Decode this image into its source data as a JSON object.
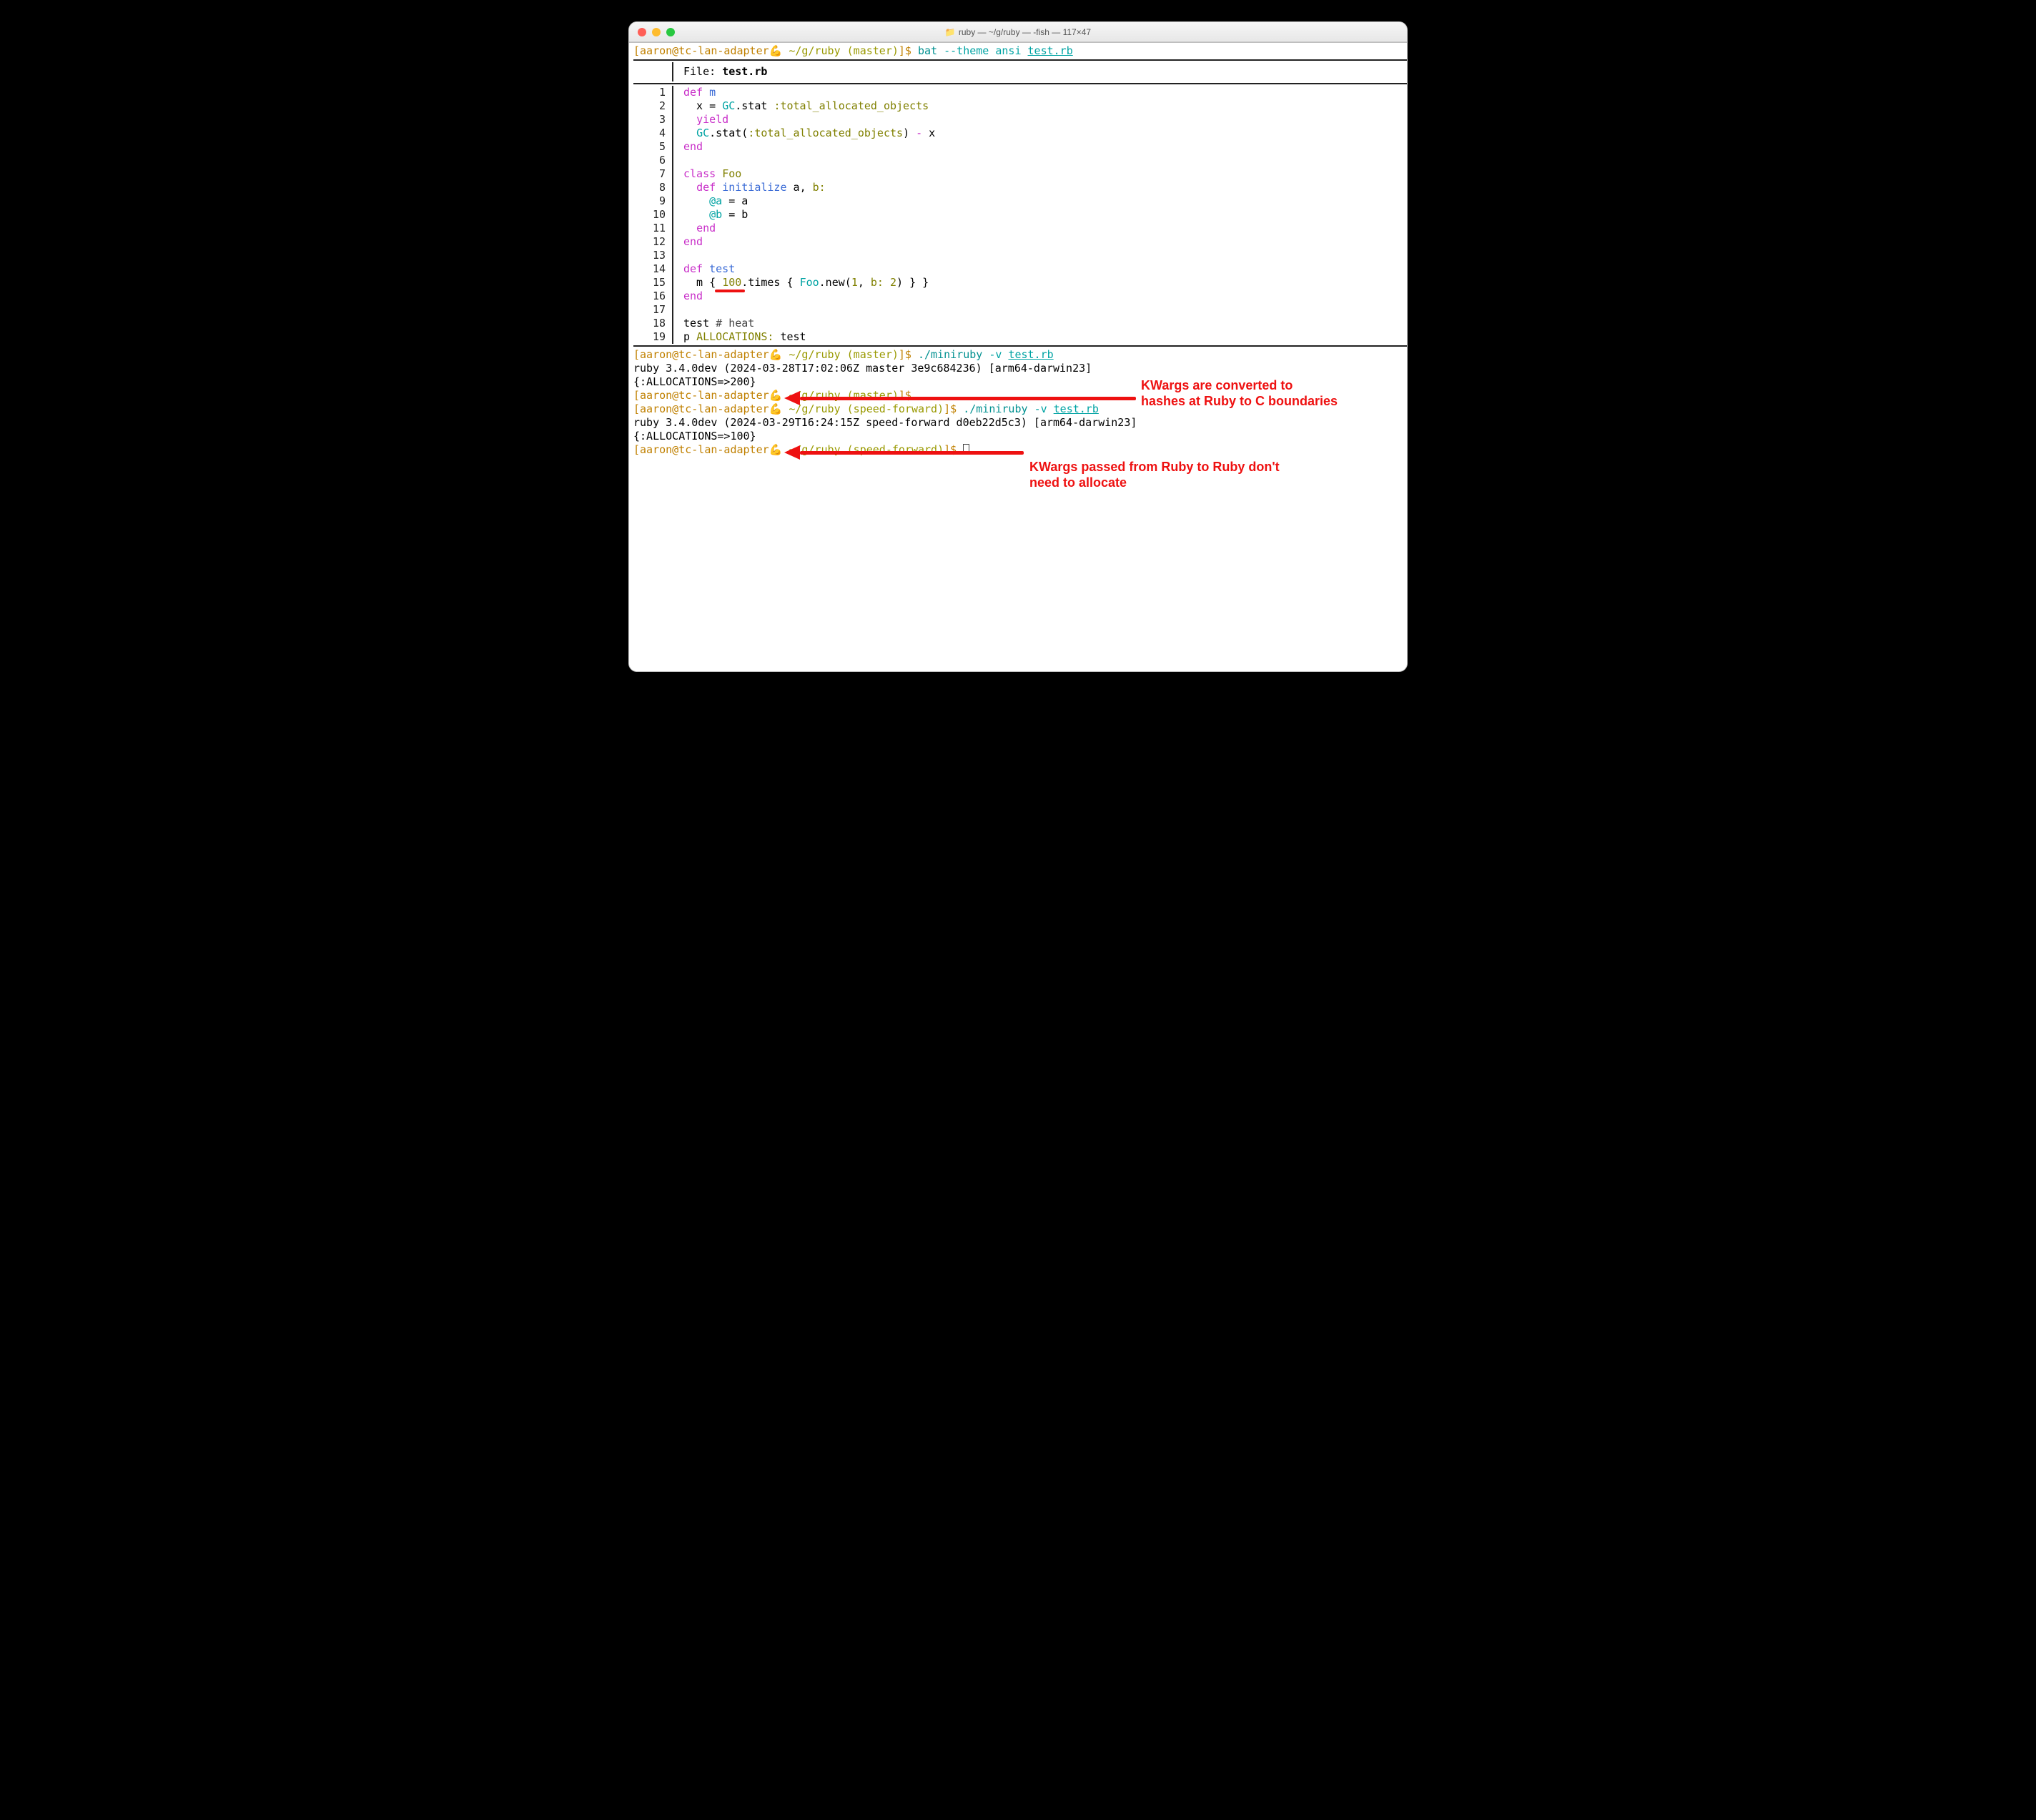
{
  "window": {
    "title": "ruby — ~/g/ruby — -fish — 117×47",
    "folder_icon": "📁"
  },
  "prompt_top": {
    "user_host": "[aaron@tc-lan-adapter",
    "emoji": "💪",
    "path_branch": "~/g/ruby (master)",
    "sigil": "]$ ",
    "cmd": "bat ",
    "opt": "--theme ansi ",
    "arg": "test.rb"
  },
  "bat": {
    "file_label": "File: ",
    "file_name": "test.rb",
    "lines": [
      {
        "n": "1",
        "tokens": [
          [
            "def ",
            "c-magenta"
          ],
          [
            "m",
            "c-blue"
          ]
        ]
      },
      {
        "n": "2",
        "tokens": [
          [
            "  x = ",
            ""
          ],
          [
            "GC",
            "c-cyan"
          ],
          [
            ".stat ",
            ""
          ],
          [
            ":total_allocated_objects",
            "c-olive"
          ]
        ]
      },
      {
        "n": "3",
        "tokens": [
          [
            "  ",
            ""
          ],
          [
            "yield",
            "c-magenta"
          ]
        ]
      },
      {
        "n": "4",
        "tokens": [
          [
            "  ",
            ""
          ],
          [
            "GC",
            "c-cyan"
          ],
          [
            ".stat(",
            ""
          ],
          [
            ":total_allocated_objects",
            "c-olive"
          ],
          [
            ") ",
            ""
          ],
          [
            "-",
            "c-magenta"
          ],
          [
            " x",
            ""
          ]
        ]
      },
      {
        "n": "5",
        "tokens": [
          [
            "end",
            "c-magenta"
          ]
        ]
      },
      {
        "n": "6",
        "tokens": [
          [
            "",
            ""
          ]
        ]
      },
      {
        "n": "7",
        "tokens": [
          [
            "class ",
            "c-magenta"
          ],
          [
            "Foo",
            "c-olive"
          ]
        ]
      },
      {
        "n": "8",
        "tokens": [
          [
            "  ",
            ""
          ],
          [
            "def ",
            "c-magenta"
          ],
          [
            "initialize ",
            "c-blue"
          ],
          [
            "a",
            ""
          ],
          [
            ", ",
            ""
          ],
          [
            "b:",
            "c-olive"
          ]
        ]
      },
      {
        "n": "9",
        "tokens": [
          [
            "    ",
            ""
          ],
          [
            "@a",
            "c-cyan"
          ],
          [
            " = a",
            ""
          ]
        ]
      },
      {
        "n": "10",
        "tokens": [
          [
            "    ",
            ""
          ],
          [
            "@b",
            "c-cyan"
          ],
          [
            " = b",
            ""
          ]
        ]
      },
      {
        "n": "11",
        "tokens": [
          [
            "  ",
            ""
          ],
          [
            "end",
            "c-magenta"
          ]
        ]
      },
      {
        "n": "12",
        "tokens": [
          [
            "end",
            "c-magenta"
          ]
        ]
      },
      {
        "n": "13",
        "tokens": [
          [
            "",
            ""
          ]
        ]
      },
      {
        "n": "14",
        "tokens": [
          [
            "def ",
            "c-magenta"
          ],
          [
            "test",
            "c-blue"
          ]
        ]
      },
      {
        "n": "15",
        "tokens": [
          [
            "  m { ",
            ""
          ],
          [
            "100",
            "c-olive"
          ],
          [
            ".times { ",
            ""
          ],
          [
            "Foo",
            "c-cyan"
          ],
          [
            ".new(",
            ""
          ],
          [
            "1",
            "c-olive"
          ],
          [
            ", ",
            ""
          ],
          [
            "b:",
            "c-olive"
          ],
          [
            " ",
            ""
          ],
          [
            "2",
            "c-olive"
          ],
          [
            ") } }",
            ""
          ]
        ]
      },
      {
        "n": "16",
        "tokens": [
          [
            "end",
            "c-magenta"
          ]
        ]
      },
      {
        "n": "17",
        "tokens": [
          [
            "",
            ""
          ]
        ]
      },
      {
        "n": "18",
        "tokens": [
          [
            "test ",
            ""
          ],
          [
            "# heat",
            "c-gray"
          ]
        ]
      },
      {
        "n": "19",
        "tokens": [
          [
            "p ",
            ""
          ],
          [
            "ALLOCATIONS:",
            "c-olive"
          ],
          [
            " test",
            ""
          ]
        ]
      }
    ]
  },
  "output_prompt1": {
    "user_host": "[aaron@tc-lan-adapter",
    "emoji": "💪",
    "path_branch": "~/g/ruby (master)",
    "sigil": "]$ ",
    "cmd": "./miniruby ",
    "opt": "-v ",
    "arg": "test.rb"
  },
  "output": {
    "ruby_ver_master": "ruby 3.4.0dev (2024-03-28T17:02:06Z master 3e9c684236) [arm64-darwin23]",
    "alloc_master": "{:ALLOCATIONS=>200}",
    "ruby_ver_speed": "ruby 3.4.0dev (2024-03-29T16:24:15Z speed-forward d0eb22d5c3) [arm64-darwin23]",
    "alloc_speed": "{:ALLOCATIONS=>100}"
  },
  "output_prompt_blank": {
    "user_host": "[aaron@tc-lan-adapter",
    "emoji": "💪",
    "path_branch": "~/g/ruby (master)",
    "sigil": "]$ "
  },
  "output_prompt2": {
    "user_host": "[aaron@tc-lan-adapter",
    "emoji": "💪",
    "path_branch": "~/g/ruby (speed-forward)",
    "sigil": "]$ ",
    "cmd": "./miniruby ",
    "opt": "-v ",
    "arg": "test.rb"
  },
  "output_prompt3": {
    "user_host": "[aaron@tc-lan-adapter",
    "emoji": "💪",
    "path_branch": "~/g/ruby (speed-forward)",
    "sigil": "]$ "
  },
  "annotations": {
    "a1_line1": "KWargs are converted to",
    "a1_line2": "hashes at Ruby to C boundaries",
    "a2_line1": "KWargs passed from Ruby to Ruby don't",
    "a2_line2": "need to allocate"
  }
}
